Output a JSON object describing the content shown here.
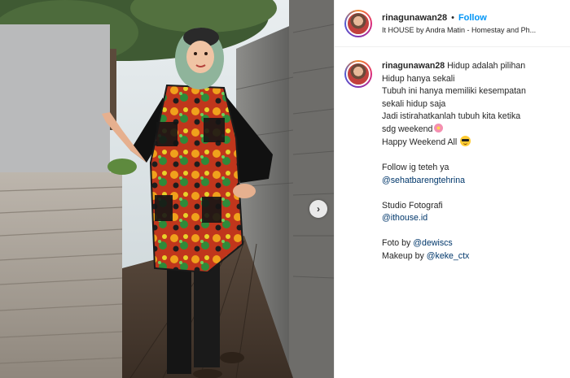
{
  "post": {
    "username": "rinagunawan28",
    "separator": "•",
    "follow_label": "Follow",
    "location": "It HOUSE by Andra Matin - Homestay and Ph..."
  },
  "caption": {
    "username": "rinagunawan28",
    "line1": "Hidup adalah pilihan",
    "line2": "Hidup hanya sekali",
    "line3": "Tubuh ini hanya memiliki kesempatan",
    "line4": "sekali hidup saja",
    "line5": "Jadi istirahatkanlah tubuh kita ketika",
    "line6": "sdg weekend",
    "line7": "Happy Weekend All",
    "follow_line": "Follow ig teteh ya",
    "mention1": "@sehatbarengtehrina",
    "studio_label": "Studio Fotografi",
    "mention2": "@ithouse.id",
    "foto_label": "Foto by",
    "mention3": "@dewiscs",
    "makeup_label": "Makeup by",
    "mention4": "@keke_ctx"
  },
  "media": {
    "next_arrow": "›"
  },
  "icons": {
    "flower": "blossom-emoji-icon",
    "sunglasses": "sunglasses-emoji-icon",
    "next": "chevron-right-icon"
  },
  "colors": {
    "link": "#0095f6",
    "mention": "#00376b",
    "text": "#262626"
  }
}
